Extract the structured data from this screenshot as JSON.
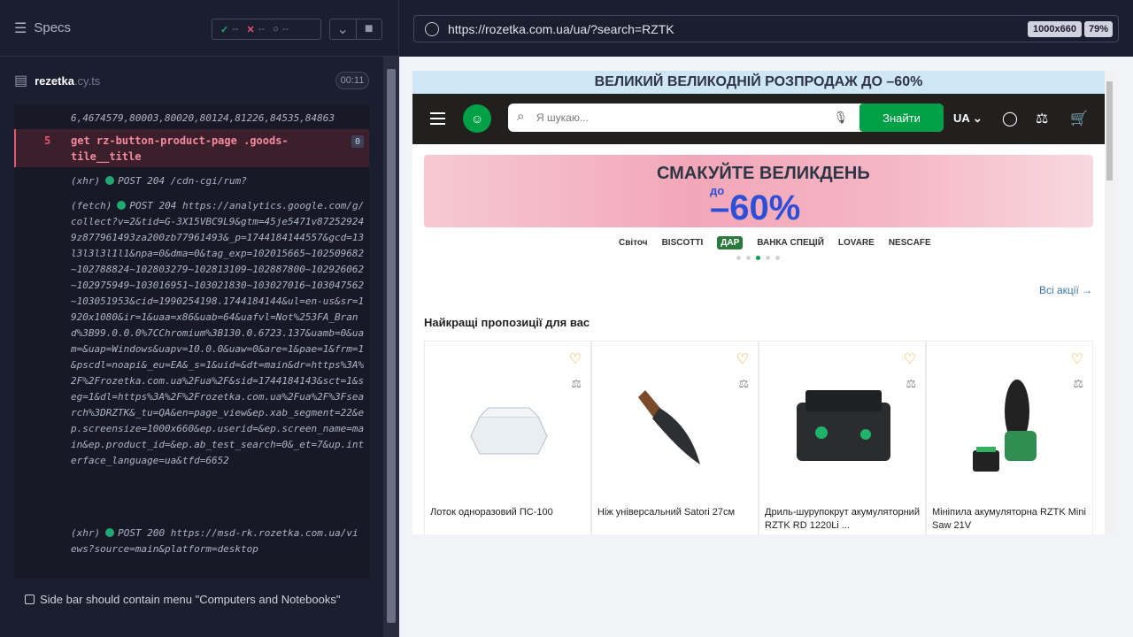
{
  "runner": {
    "specs_label": "Specs",
    "stats": {
      "passed": "--",
      "failed": "--",
      "pending": "--"
    },
    "file": {
      "name": "rezetka",
      "ext": ".cy.ts",
      "timer": "00:11"
    },
    "log_top": "6,4674579,80003,80020,80124,81226,84535,84863",
    "command": {
      "number": "5",
      "text": "get  rz-button-product-page .goods-tile__title",
      "badge": "0"
    },
    "log1_type": "(xhr)",
    "log1": "POST 204 /cdn-cgi/rum?",
    "log2_type": "(fetch)",
    "log2_head": "POST 204",
    "log2_url": "https://analytics.google.com/g/collect?v=2&tid=G-3X15VBC9L9&gtm=45je5471v872529249z877961493za200zb77961493&_p=1744184144557&gcd=13l3l3l3l1l1&npa=0&dma=0&tag_exp=102015665~102509682~102788824~102803279~102813109~102887800~102926062~102975949~103016951~103021830~103027016~103047562~103051953&cid=1990254198.1744184144&ul=en-us&sr=1920x1080&ir=1&uaa=x86&uab=64&uafvl=Not%253FA_Brand%3B99.0.0.0%7CChromium%3B130.0.6723.137&uamb=0&uam=&uap=Windows&uapv=10.0.0&uaw=0&are=1&pae=1&frm=1&pscdl=noapi&_eu=EA&_s=1&uid=&dt=main&dr=https%3A%2F%2Frozetka.com.ua%2Fua%2F&sid=1744184143&sct=1&seg=1&dl=https%3A%2F%2Frozetka.com.ua%2Fua%2F%3Fsearch%3DRZTK&_tu=QA&en=page_view&ep.xab_segment=22&ep.screensize=1000x660&ep.userid=&ep.screen_name=main&ep.product_id=&ep.ab_test_search=0&_et=7&up.interface_language=ua&tfd=6652",
    "log3_type": "(xhr)",
    "log3": "POST 200 https://msd-rk.rozetka.com.ua/views?source=main&platform=desktop",
    "test_title": "Side bar should contain menu \"Computers and Notebooks\""
  },
  "browser": {
    "url": "https://rozetka.com.ua/ua/?search=RZTK",
    "viewport": "1000x660",
    "zoom": "79%"
  },
  "site": {
    "promo": "ВЕЛИКИЙ ВЕЛИКОДНІЙ РОЗПРОДАЖ ДО –60%",
    "search_placeholder": "Я шукаю...",
    "search_button": "Знайти",
    "lang": "UA",
    "banner_title": "СМАКУЙТЕ ВЕЛИКДЕНЬ",
    "banner_discount": "–60%",
    "banner_do": "до",
    "brands": [
      "Світоч",
      "BISCOTTI",
      "ДАР",
      "ВАНКА СПЕЦІЙ",
      "LOVARE",
      "NESCAFE"
    ],
    "all_promos": "Всі акції →",
    "section_title": "Найкращі пропозиції для вас",
    "products": [
      {
        "name": "Лоток одноразовий ПС-100"
      },
      {
        "name": "Ніж універсальний Satori 27см"
      },
      {
        "name": "Дриль-шурупокрут акумуляторний RZTK RD 1220Li ..."
      },
      {
        "name": "Мініпила акумуляторна RZTK Mini Saw 21V"
      }
    ]
  }
}
